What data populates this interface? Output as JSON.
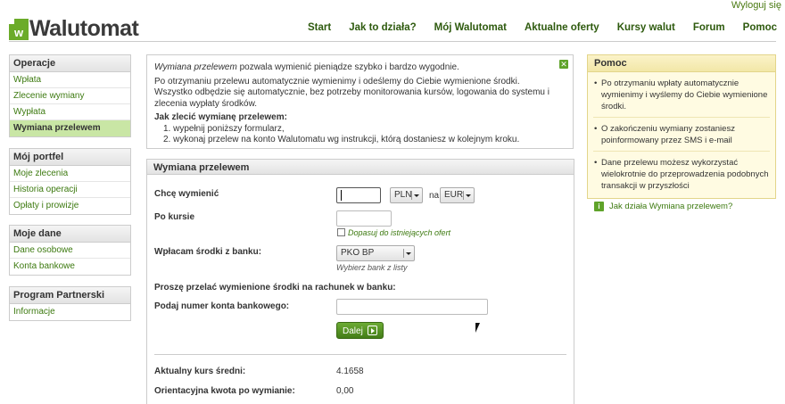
{
  "header": {
    "logout": "Wyloguj się",
    "logo_letter": "w",
    "logo_text": "Walutomat",
    "nav": [
      "Start",
      "Jak to działa?",
      "Mój Walutomat",
      "Aktualne oferty",
      "Kursy walut",
      "Forum",
      "Pomoc"
    ]
  },
  "sidebar": {
    "operacje": {
      "title": "Operacje",
      "items": [
        "Wpłata",
        "Zlecenie wymiany",
        "Wypłata",
        "Wymiana przelewem"
      ],
      "active": "Wymiana przelewem"
    },
    "portfel": {
      "title": "Mój portfel",
      "items": [
        "Moje zlecenia",
        "Historia operacji",
        "Opłaty i prowizje"
      ]
    },
    "dane": {
      "title": "Moje dane",
      "items": [
        "Dane osobowe",
        "Konta bankowe"
      ]
    },
    "partner": {
      "title": "Program Partnerski",
      "items": [
        "Informacje"
      ]
    }
  },
  "info": {
    "intro_em": "Wymiana przelewem",
    "intro_rest": " pozwala wymienić pieniądze szybko i bardzo wygodnie.",
    "p2": "Po otrzymaniu przelewu automatycznie wymienimy i odeślemy do Ciebie wymienione środki.",
    "p3": "Wszystko odbędzie się automatycznie, bez potrzeby monitorowania kursów, logowania do systemu i zlecenia wypłaty środków.",
    "how_title": "Jak zlecić wymianę przelewem:",
    "steps": [
      "1.  wypełnij poniższy formularz,",
      "2.  wykonaj przelew na konto Walutomatu wg instrukcji, którą dostaniesz w kolejnym kroku."
    ]
  },
  "form": {
    "title": "Wymiana przelewem",
    "want_label": "Chcę wymienić",
    "amount_value": "",
    "from_currency": "PLN",
    "na_label": "na",
    "to_currency": "EUR",
    "rate_label": "Po kursie",
    "rate_value": "",
    "match_offers_label": "Dopasuj do istniejących ofert",
    "bank_label": "Wpłacam środki z banku:",
    "bank_value": "PKO BP",
    "bank_hint": "Wybierz bank z listy",
    "transfer_prompt": "Proszę przelać wymienione środki na rachunek w banku:",
    "account_label": "Podaj numer konta bankowego:",
    "account_value": "",
    "next_button": "Dalej",
    "avg_rate_label": "Aktualny kurs średni:",
    "avg_rate_value": "4.1658",
    "approx_amount_label": "Orientacyjna kwota po wymianie:",
    "approx_amount_value": "0,00"
  },
  "help": {
    "title": "Pomoc",
    "items": [
      "Po otrzymaniu wpłaty automatycznie wymienimy i wyślemy do Ciebie wymienione środki.",
      "O zakończeniu wymiany zostaniesz poinformowany przez SMS i e-mail",
      "Dane przelewu możesz wykorzystać wielokrotnie do przeprowadzenia podobnych transakcji w przyszłości"
    ],
    "link_icon": "i",
    "link": "Jak działa Wymiana przelewem?"
  },
  "colors": {
    "accent": "#5fa32a",
    "link": "#3d7a10",
    "active_bg": "#c9e6a5",
    "help_bg": "#fffbe2"
  }
}
